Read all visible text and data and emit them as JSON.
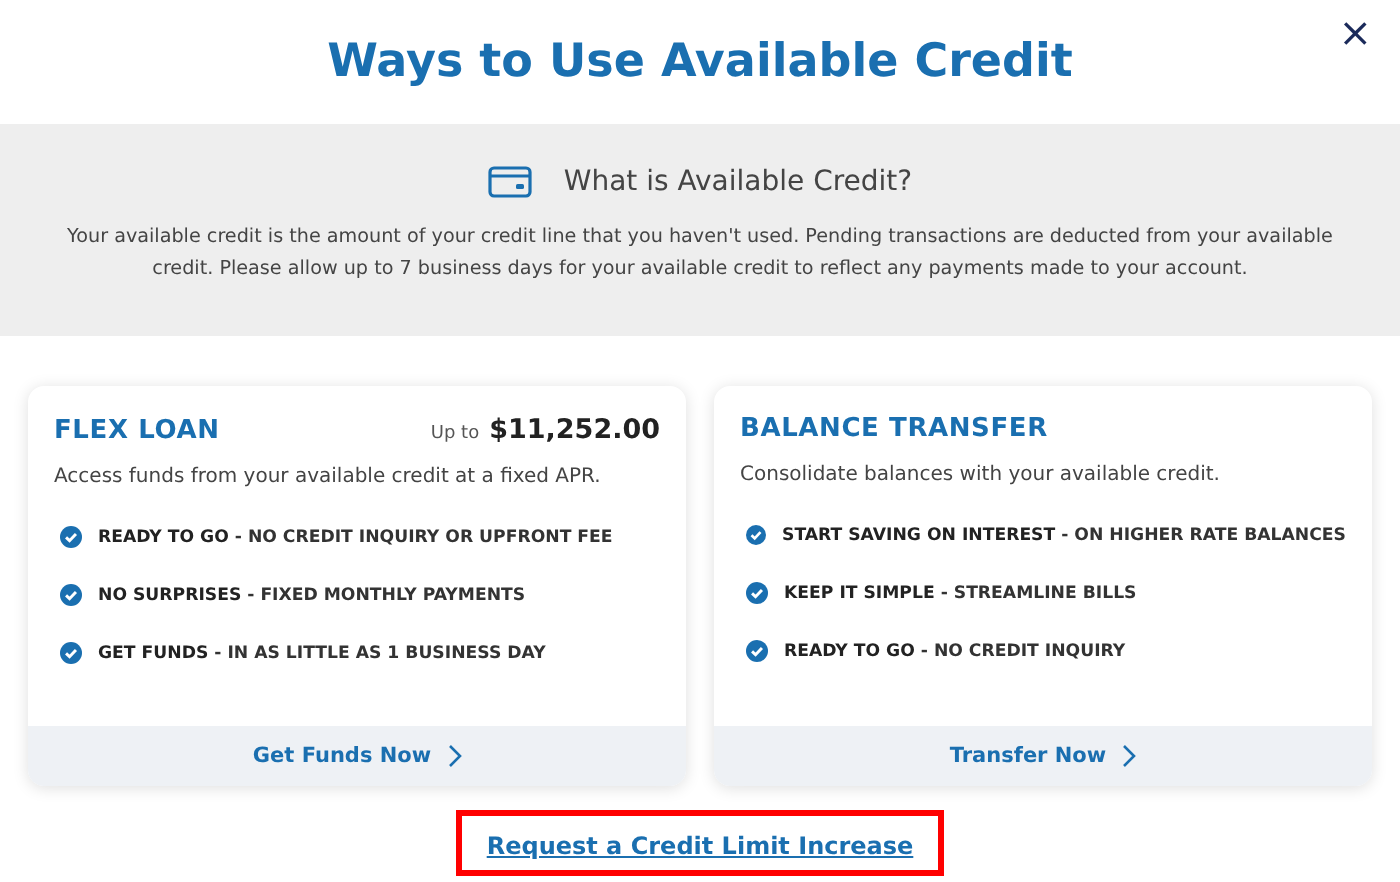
{
  "dialog": {
    "title": "Ways to Use Available Credit",
    "close": "×"
  },
  "info": {
    "heading": "What is Available Credit?",
    "text": "Your available credit is the amount of your credit line that you haven't used. Pending transactions are deducted from your available credit. Please allow up to 7 business days for your available credit to reflect any payments made to your account."
  },
  "cards": [
    {
      "title": "FLEX LOAN",
      "amount_prefix": "Up to",
      "amount": "$11,252.00",
      "description": "Access funds from your available credit at a fixed APR.",
      "features": [
        "**READY TO GO** - NO CREDIT INQUIRY OR UPFRONT FEE",
        "**NO SURPRISES** - FIXED MONTHLY PAYMENTS",
        "**GET FUNDS** - IN AS LITTLE AS 1 BUSINESS DAY"
      ],
      "action": "Get Funds Now"
    },
    {
      "title": "BALANCE TRANSFER",
      "description": "Consolidate balances with your available credit.",
      "features": [
        "**START SAVING ON INTEREST** - ON HIGHER RATE BALANCES",
        "**KEEP IT SIMPLE** - STREAMLINE BILLS",
        "**READY TO GO** - NO CREDIT INQUIRY"
      ],
      "action": "Transfer Now"
    }
  ],
  "link": {
    "label": "Request a Credit Limit Increase",
    "highlighted": true
  }
}
